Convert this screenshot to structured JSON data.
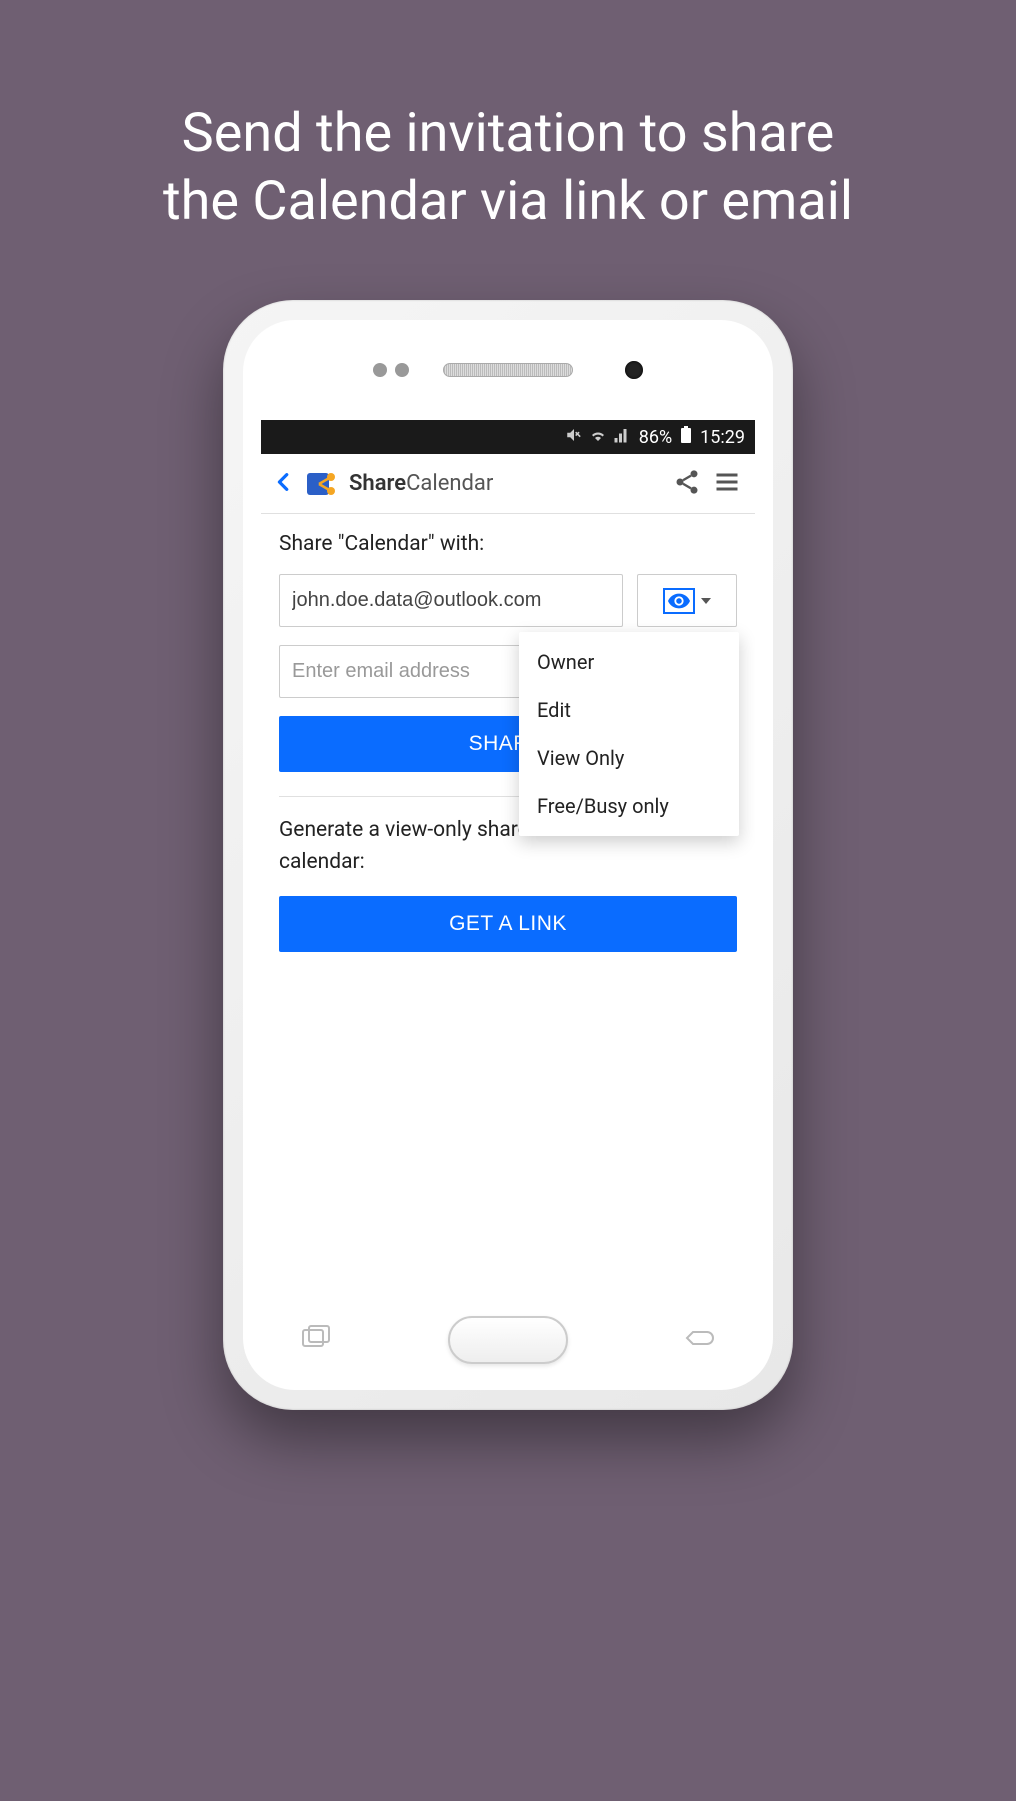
{
  "promo": {
    "line1": "Send the invitation to share",
    "line2": "the Calendar via link or email"
  },
  "status_bar": {
    "battery_percent": "86%",
    "time": "15:29"
  },
  "header": {
    "app_name_bold": "Share",
    "app_name_rest": "Calendar"
  },
  "share": {
    "label": "Share \"Calendar\" with:",
    "email_value": "john.doe.data@outlook.com",
    "email_placeholder": "Enter email address",
    "share_button": "SHARE",
    "permission_options": [
      "Owner",
      "Edit",
      "View Only",
      "Free/Busy only"
    ]
  },
  "link": {
    "description": "Generate a view-only shareable link to access the calendar:",
    "button": "GET A LINK"
  }
}
